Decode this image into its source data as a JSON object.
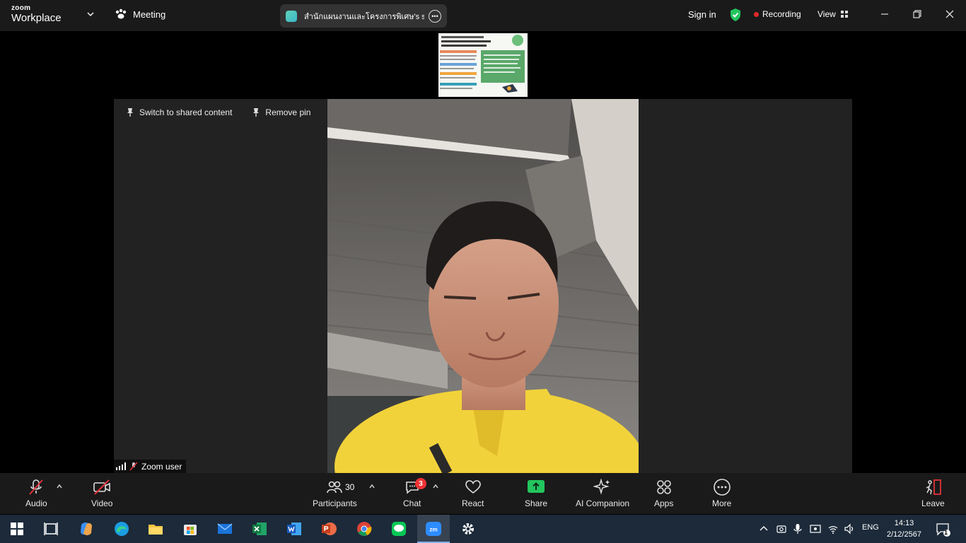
{
  "app": {
    "logo_top": "zoom",
    "logo_bottom": "Workplace",
    "meeting_label": "Meeting",
    "share_title": "สำนักแผนงานและโครงการพิเศษ's scre",
    "sign_in": "Sign in",
    "recording": "Recording",
    "view": "View"
  },
  "stage": {
    "switch_label": "Switch to shared content",
    "remove_pin_label": "Remove pin",
    "participant_name": "Zoom user"
  },
  "toolbar": {
    "audio": "Audio",
    "video": "Video",
    "participants": "Participants",
    "participants_count": "30",
    "chat": "Chat",
    "chat_badge": "3",
    "react": "React",
    "share": "Share",
    "ai_companion": "AI Companion",
    "apps": "Apps",
    "more": "More",
    "leave": "Leave"
  },
  "taskbar": {
    "language": "ENG",
    "time": "14:13",
    "date": "2/12/2567",
    "notification_count": "1"
  },
  "colors": {
    "accent_green": "#22c55e",
    "recording_red": "#e02828",
    "leave_red": "#e0323a",
    "shirt_yellow": "#f2d23a"
  }
}
